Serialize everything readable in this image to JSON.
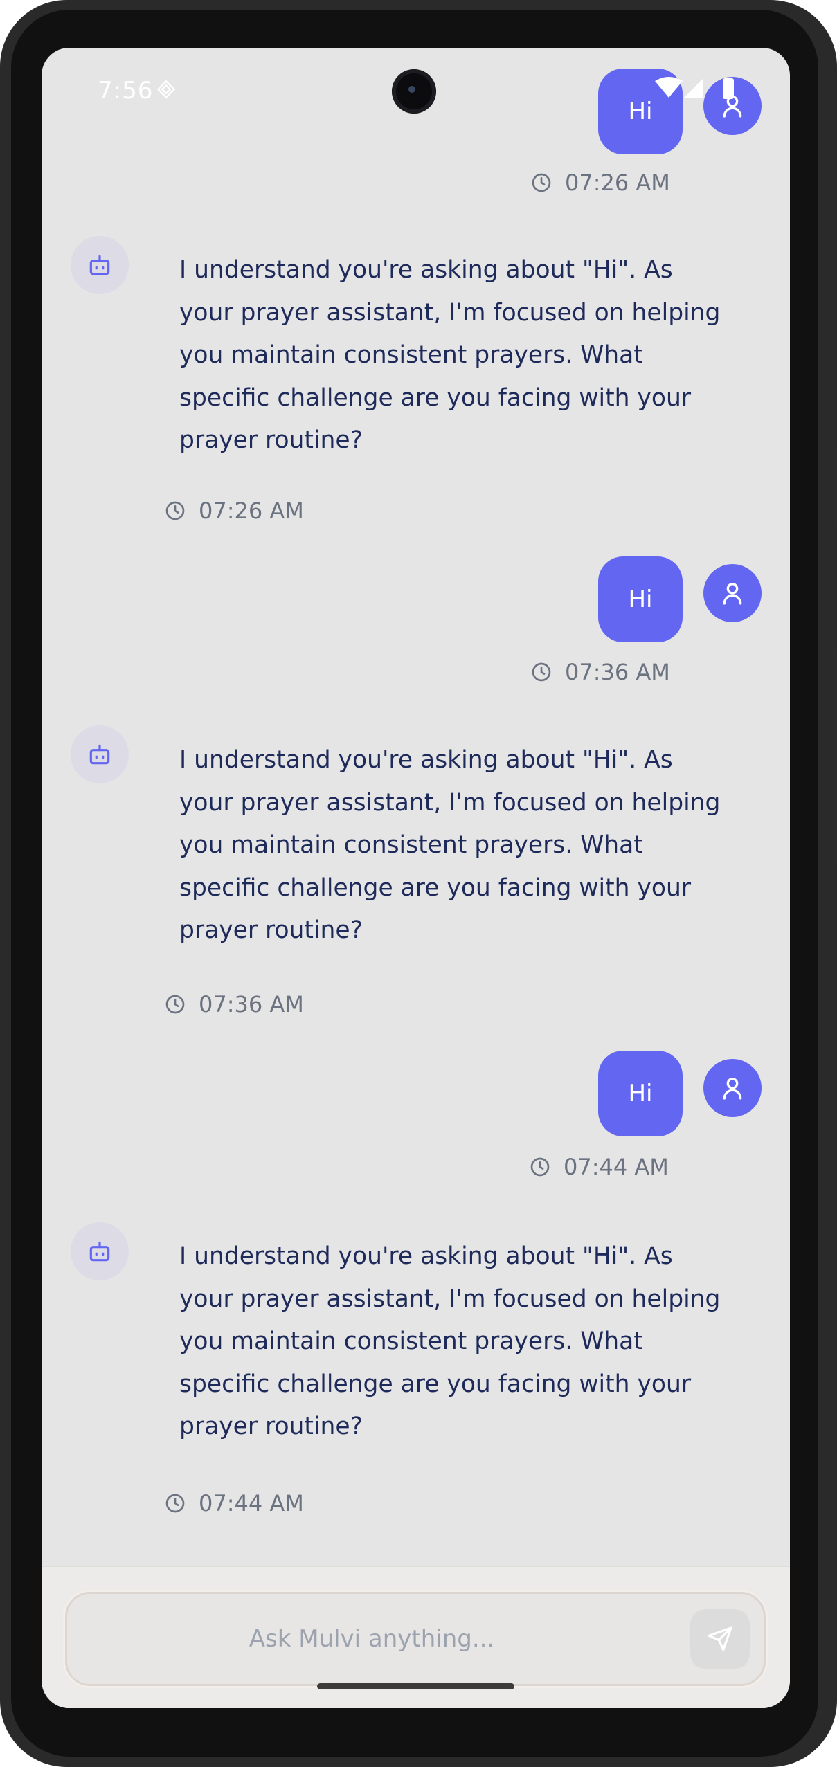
{
  "status_bar": {
    "time": "7:56"
  },
  "chat": {
    "messages": [
      {
        "role": "user",
        "text": "Hi",
        "time": "07:26 AM"
      },
      {
        "role": "assistant",
        "text": "I understand you're asking about \"Hi\". As your prayer assistant, I'm focused on helping you maintain consistent prayers. What specific challenge are you facing with your prayer routine?",
        "time": "07:26 AM"
      },
      {
        "role": "user",
        "text": "Hi",
        "time": "07:36 AM"
      },
      {
        "role": "assistant",
        "text": "I understand you're asking about \"Hi\". As your prayer assistant, I'm focused on helping you maintain consistent prayers. What specific challenge are you facing with your prayer routine?",
        "time": "07:36 AM"
      },
      {
        "role": "user",
        "text": "Hi",
        "time": "07:44 AM"
      },
      {
        "role": "assistant",
        "text": "I understand you're asking about \"Hi\". As your prayer assistant, I'm focused on helping you maintain consistent prayers. What specific challenge are you facing with your prayer routine?",
        "time": "07:44 AM"
      }
    ]
  },
  "composer": {
    "placeholder": "Ask Mulvi anything..."
  },
  "icons": {
    "user_avatar": "user-icon",
    "bot_avatar": "robot-icon",
    "timestamp": "clock-icon",
    "send": "send-icon"
  },
  "colors": {
    "accent": "#6366f1",
    "background": "#e6e5e5",
    "bot_text": "#1e2a5a",
    "muted_text": "#6b7280"
  }
}
